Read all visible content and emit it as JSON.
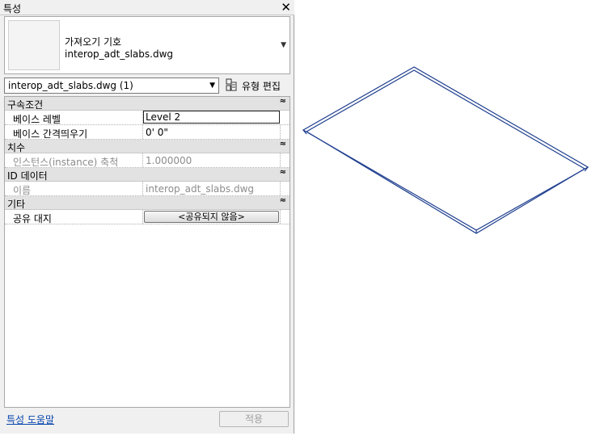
{
  "palette": {
    "title": "특성",
    "close_glyph": "✕"
  },
  "type_selector": {
    "family": "가져오기 기호",
    "type": "interop_adt_slabs.dwg",
    "arrow": "▼"
  },
  "instance_filter": {
    "value": "interop_adt_slabs.dwg (1)",
    "arrow": "▼"
  },
  "edit_type": {
    "label": "유형 편집"
  },
  "groups": {
    "constraints": {
      "label": "구속조건",
      "collapse": "≈"
    },
    "dimensions": {
      "label": "치수",
      "collapse": "≈"
    },
    "identity": {
      "label": "ID 데이터",
      "collapse": "≈"
    },
    "other": {
      "label": "기타",
      "collapse": "≈"
    }
  },
  "params": {
    "base_level": {
      "name": "베이스 레벨",
      "value": "Level 2"
    },
    "base_offset": {
      "name": "베이스 간격띄우기",
      "value": "0'   0\""
    },
    "instance_scale": {
      "name": "인스턴스(instance) 축척",
      "value": "1.000000"
    },
    "name": {
      "name": "이름",
      "value": "interop_adt_slabs.dwg"
    },
    "shared_site": {
      "name": "공유 대지",
      "value": "<공유되지 않음>"
    }
  },
  "footer": {
    "help_link": "특성 도움말",
    "apply": "적용"
  },
  "colors": {
    "link": "#0645ad",
    "model_line": "#1f3f8f",
    "group_header": "#e2e2e2"
  },
  "icons": [
    "close-icon",
    "dropdown-arrow-icon",
    "edit-type-icon",
    "collapse-icon"
  ]
}
